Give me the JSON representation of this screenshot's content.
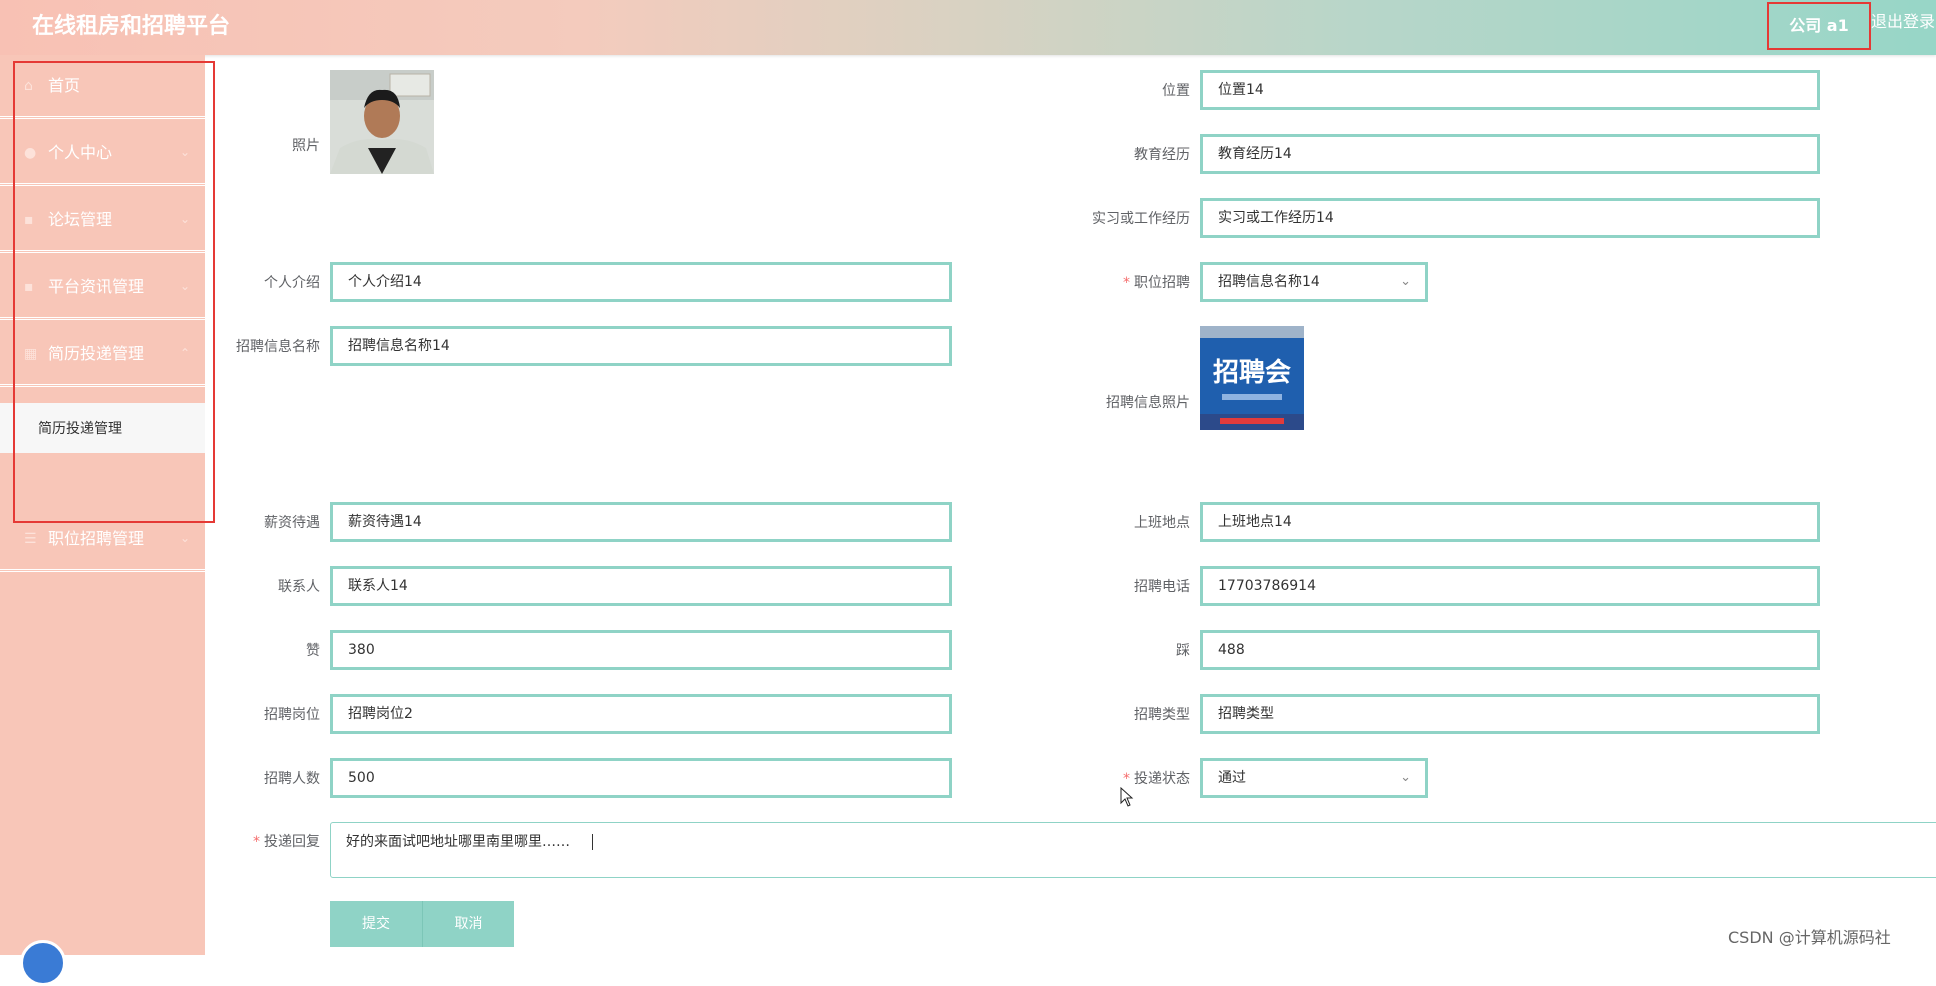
{
  "header": {
    "title": "在线租房和招聘平台",
    "user": "公司 a1",
    "logout": "退出登录"
  },
  "sidebar": {
    "items": [
      {
        "label": "首页",
        "icon": "home-icon"
      },
      {
        "label": "个人中心",
        "icon": "user-icon"
      },
      {
        "label": "论坛管理",
        "icon": "forum-icon"
      },
      {
        "label": "平台资讯管理",
        "icon": "news-icon"
      },
      {
        "label": "简历投递管理",
        "icon": "resume-icon"
      },
      {
        "label": "职位招聘管理",
        "icon": "job-icon"
      }
    ],
    "submenu": "简历投递管理"
  },
  "form": {
    "photo_label": "照片",
    "location_label": "位置",
    "location_value": "位置14",
    "education_label": "教育经历",
    "education_value": "教育经历14",
    "experience_label": "实习或工作经历",
    "experience_value": "实习或工作经历14",
    "intro_label": "个人介绍",
    "intro_value": "个人介绍14",
    "position_label": "职位招聘",
    "position_value": "招聘信息名称14",
    "info_name_label": "招聘信息名称",
    "info_name_value": "招聘信息名称14",
    "info_photo_label": "招聘信息照片",
    "info_photo_text": "招聘会",
    "salary_label": "薪资待遇",
    "salary_value": "薪资待遇14",
    "workplace_label": "上班地点",
    "workplace_value": "上班地点14",
    "contact_label": "联系人",
    "contact_value": "联系人14",
    "phone_label": "招聘电话",
    "phone_value": "17703786914",
    "like_label": "赞",
    "like_value": "380",
    "dislike_label": "踩",
    "dislike_value": "488",
    "post_label": "招聘岗位",
    "post_value": "招聘岗位2",
    "type_label": "招聘类型",
    "type_value": "招聘类型",
    "count_label": "招聘人数",
    "count_value": "500",
    "status_label": "投递状态",
    "status_value": "通过",
    "reply_label": "投递回复",
    "reply_value": "好的来面试吧地址哪里南里哪里……",
    "submit": "提交",
    "cancel": "取消"
  },
  "watermark": "CSDN @计算机源码社",
  "colors": {
    "accent": "#8fd3c6",
    "sidebar": "#f8c6b8",
    "highlight_box": "#e53935"
  }
}
